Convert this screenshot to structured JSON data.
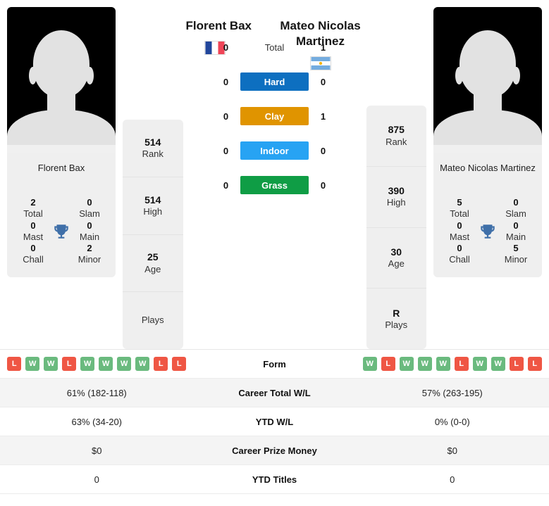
{
  "players": {
    "left": {
      "name": "Florent Bax",
      "flag": {
        "country": "France",
        "icon": "france-flag-icon",
        "bands": [
          "#21469b",
          "#ffffff",
          "#ef4557"
        ]
      },
      "avatar_alt": "Florent Bax",
      "trophies": {
        "name": "Florent Bax",
        "total": "2",
        "total_label": "Total",
        "slam": "0",
        "slam_label": "Slam",
        "mast": "0",
        "mast_label": "Mast",
        "main": "0",
        "main_label": "Main",
        "chall": "0",
        "chall_label": "Chall",
        "minor": "2",
        "minor_label": "Minor",
        "icon": "trophy-icon"
      },
      "profile": {
        "rank": "514",
        "rank_label": "Rank",
        "high": "514",
        "high_label": "High",
        "age": "25",
        "age_label": "Age",
        "plays": "",
        "plays_label": "Plays"
      },
      "surface_scores": {
        "total": "0",
        "hard": "0",
        "clay": "0",
        "indoor": "0",
        "grass": "0"
      },
      "form": [
        "L",
        "W",
        "W",
        "L",
        "W",
        "W",
        "W",
        "W",
        "L",
        "L"
      ],
      "career_total_wl": "61% (182-118)",
      "ytd_wl": "63% (34-20)",
      "career_prize_money": "$0",
      "ytd_titles": "0"
    },
    "right": {
      "name": "Mateo Nicolas Martinez",
      "flag": {
        "country": "Argentina",
        "icon": "argentina-flag-icon",
        "bands": [
          "#74acdf",
          "#ffffff",
          "#74acdf"
        ],
        "sun": "#f6b40e"
      },
      "avatar_alt": "Mateo Nicolas Martinez",
      "trophies": {
        "name": "Mateo Nicolas Martinez",
        "total": "5",
        "total_label": "Total",
        "slam": "0",
        "slam_label": "Slam",
        "mast": "0",
        "mast_label": "Mast",
        "main": "0",
        "main_label": "Main",
        "chall": "0",
        "chall_label": "Chall",
        "minor": "5",
        "minor_label": "Minor",
        "icon": "trophy-icon"
      },
      "profile": {
        "rank": "875",
        "rank_label": "Rank",
        "high": "390",
        "high_label": "High",
        "age": "30",
        "age_label": "Age",
        "plays": "R",
        "plays_label": "Plays"
      },
      "surface_scores": {
        "total": "1",
        "hard": "0",
        "clay": "1",
        "indoor": "0",
        "grass": "0"
      },
      "form": [
        "W",
        "L",
        "W",
        "W",
        "W",
        "L",
        "W",
        "W",
        "L",
        "L"
      ],
      "career_total_wl": "57% (263-195)",
      "ytd_wl": "0% (0-0)",
      "career_prize_money": "$0",
      "ytd_titles": "0"
    }
  },
  "surfaces": [
    {
      "key": "total",
      "label": "Total",
      "color": "transparent",
      "text_color": "#333333",
      "plain": true
    },
    {
      "key": "hard",
      "label": "Hard",
      "color": "#0d6fc0",
      "text_color": "#ffffff",
      "plain": false
    },
    {
      "key": "clay",
      "label": "Clay",
      "color": "#e09400",
      "text_color": "#ffffff",
      "plain": false
    },
    {
      "key": "indoor",
      "label": "Indoor",
      "color": "#27a3f3",
      "text_color": "#ffffff",
      "plain": false
    },
    {
      "key": "grass",
      "label": "Grass",
      "color": "#0f9d45",
      "text_color": "#ffffff",
      "plain": false
    }
  ],
  "table": {
    "rows": [
      {
        "label": "Form",
        "type": "form",
        "left": "",
        "right": ""
      },
      {
        "label": "Career Total W/L",
        "type": "text",
        "left": "61% (182-118)",
        "right": "57% (263-195)"
      },
      {
        "label": "YTD W/L",
        "type": "text",
        "left": "63% (34-20)",
        "right": "0% (0-0)"
      },
      {
        "label": "Career Prize Money",
        "type": "text",
        "left": "$0",
        "right": "$0"
      },
      {
        "label": "YTD Titles",
        "type": "text",
        "left": "0",
        "right": "0"
      }
    ]
  },
  "colors": {
    "win_badge": "#6aba7e",
    "loss_badge": "#ef5644",
    "panel_bg": "#efefef",
    "row_alt_bg": "#f4f4f4",
    "trophy": "#3f6fa8"
  }
}
